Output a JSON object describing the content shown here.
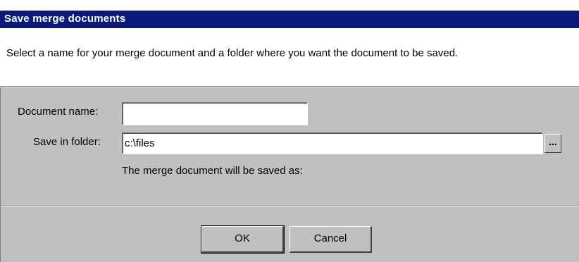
{
  "dialog": {
    "title": "Save merge documents",
    "instructions": "Select a name for your merge document and a folder where you want the document to be saved."
  },
  "form": {
    "document_name_label": "Document name:",
    "document_name_value": "",
    "folder_label": "Save in folder:",
    "folder_value": "c:\\files",
    "browse_label": "...",
    "saved_as_text": "The merge document will be saved as:"
  },
  "buttons": {
    "ok": "OK",
    "cancel": "Cancel"
  }
}
